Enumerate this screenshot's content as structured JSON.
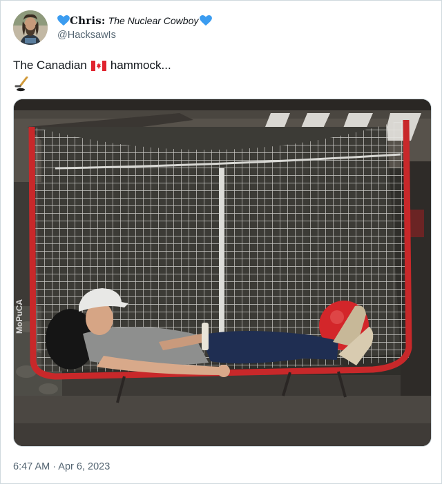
{
  "tweet": {
    "author": {
      "name_prefix": "Chris:",
      "name_suffix": "The Nuclear Cowboy",
      "handle": "@HacksawIs",
      "avatar_icon": "bearded-man-avatar",
      "heart_color": "#3b9cf0"
    },
    "text": {
      "before_flag": "The Canadian",
      "after_flag": "hammock...",
      "flag_icon": "canada-flag-icon",
      "emoji_icon": "hockey-stick-puck-icon"
    },
    "media": {
      "watermark": "MoPuCA"
    },
    "timestamp": "6:47 AM · Apr 6, 2023"
  }
}
